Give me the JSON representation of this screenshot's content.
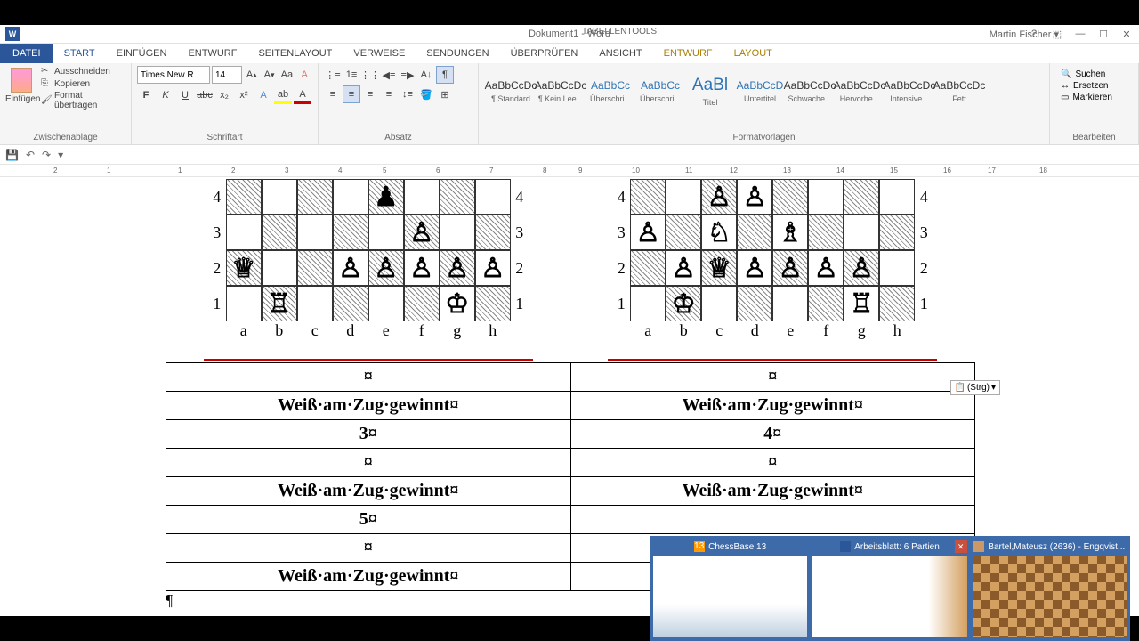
{
  "window": {
    "app_icon": "W",
    "title": "Dokument1 - Word",
    "table_tools": "TABELLENTOOLS",
    "user": "Martin Fischer"
  },
  "tabs": {
    "file": "DATEI",
    "start": "START",
    "einfugen": "EINFÜGEN",
    "entwurf": "ENTWURF",
    "seitenlayout": "SEITENLAYOUT",
    "verweise": "VERWEISE",
    "sendungen": "SENDUNGEN",
    "uberprufen": "ÜBERPRÜFEN",
    "ansicht": "ANSICHT",
    "entwurf2": "ENTWURF",
    "layout": "LAYOUT"
  },
  "ribbon": {
    "clipboard": {
      "paste": "Einfügen",
      "cut": "Ausschneiden",
      "copy": "Kopieren",
      "format": "Format übertragen",
      "label": "Zwischenablage"
    },
    "font": {
      "name": "Times New R",
      "size": "14",
      "label": "Schriftart"
    },
    "paragraph": {
      "label": "Absatz"
    },
    "styles": {
      "label": "Formatvorlagen",
      "items": [
        {
          "sample": "AaBbCcDc",
          "label": "¶ Standard"
        },
        {
          "sample": "AaBbCcDc",
          "label": "¶ Kein Lee..."
        },
        {
          "sample": "AaBbCc",
          "label": "Überschri...",
          "blue": true
        },
        {
          "sample": "AaBbCc",
          "label": "Überschri...",
          "blue": true
        },
        {
          "sample": "AaBl",
          "label": "Titel",
          "blue": true,
          "big": true
        },
        {
          "sample": "AaBbCcD",
          "label": "Untertitel",
          "blue": true
        },
        {
          "sample": "AaBbCcDc",
          "label": "Schwache..."
        },
        {
          "sample": "AaBbCcDc",
          "label": "Hervorhe..."
        },
        {
          "sample": "AaBbCcDc",
          "label": "Intensive..."
        },
        {
          "sample": "AaBbCcDc",
          "label": "Fett"
        }
      ]
    },
    "editing": {
      "find": "Suchen",
      "replace": "Ersetzen",
      "select": "Markieren",
      "label": "Bearbeiten"
    }
  },
  "ruler_marks": [
    "2",
    "1",
    "1",
    "2",
    "3",
    "4",
    "5",
    "6",
    "7",
    "8",
    "9",
    "10",
    "11",
    "12",
    "13",
    "14",
    "15",
    "16",
    "17",
    "18"
  ],
  "document": {
    "caption_left": "Weiß·am·Zug·gewinnt¤",
    "caption_right": "Weiß·am·Zug·gewinnt¤",
    "num3": "3¤",
    "num4": "4¤",
    "num5": "5¤",
    "empty": "¤",
    "files": [
      "a",
      "b",
      "c",
      "d",
      "e",
      "f",
      "g",
      "h"
    ],
    "ranks_visible": [
      "4",
      "3",
      "2",
      "1"
    ],
    "paste_btn": "(Strg)"
  },
  "taskbar": {
    "t1": "ChessBase 13",
    "t2": "Arbeitsblatt:  6 Partien",
    "t3": "Bartel,Mateusz (2636) - Engqvist..."
  }
}
